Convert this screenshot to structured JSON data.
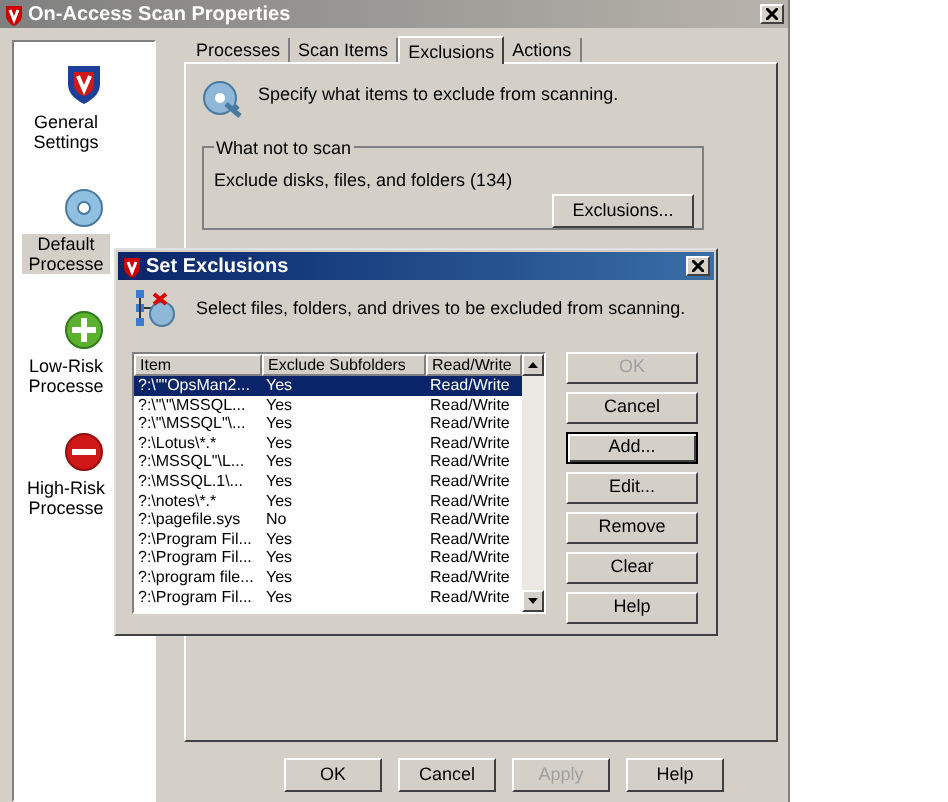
{
  "window": {
    "title": "On-Access Scan Properties"
  },
  "sidebar": {
    "items": [
      {
        "label": "General Settings",
        "kind": "shield",
        "selected": false
      },
      {
        "label": "Default Processe",
        "kind": "disc",
        "selected": true
      },
      {
        "label": "Low-Risk Processe",
        "kind": "plus",
        "selected": false
      },
      {
        "label": "High-Risk Processe",
        "kind": "minus",
        "selected": false
      }
    ]
  },
  "tabs": [
    {
      "label": "Processes",
      "selected": false
    },
    {
      "label": "Scan Items",
      "selected": false
    },
    {
      "label": "Exclusions",
      "selected": true
    },
    {
      "label": "Actions",
      "selected": false
    }
  ],
  "intro": "Specify what items to exclude from scanning.",
  "group": {
    "title": "What not to scan",
    "text": "Exclude disks, files, and folders (134)",
    "button": "Exclusions..."
  },
  "buttons": [
    {
      "label": "OK",
      "disabled": false
    },
    {
      "label": "Cancel",
      "disabled": false
    },
    {
      "label": "Apply",
      "disabled": true
    },
    {
      "label": "Help",
      "disabled": false
    }
  ],
  "dialog": {
    "title": "Set Exclusions",
    "intro": "Select files, folders, and drives to be excluded from scanning.",
    "columns": [
      "Item",
      "Exclude Subfolders",
      "Read/Write"
    ],
    "rows": [
      {
        "cells": [
          "?:\\\"\"OpsMan2...",
          "Yes",
          "Read/Write"
        ],
        "selected": true
      },
      {
        "cells": [
          "?:\\\"\\\"\\MSSQL...",
          "Yes",
          "Read/Write"
        ],
        "selected": false
      },
      {
        "cells": [
          "?:\\\"\\MSSQL\"\\...",
          "Yes",
          "Read/Write"
        ],
        "selected": false
      },
      {
        "cells": [
          "?:\\Lotus\\*.*",
          "Yes",
          "Read/Write"
        ],
        "selected": false
      },
      {
        "cells": [
          "?:\\MSSQL\"\\L...",
          "Yes",
          "Read/Write"
        ],
        "selected": false
      },
      {
        "cells": [
          "?:\\MSSQL.1\\...",
          "Yes",
          "Read/Write"
        ],
        "selected": false
      },
      {
        "cells": [
          "?:\\notes\\*.*",
          "Yes",
          "Read/Write"
        ],
        "selected": false
      },
      {
        "cells": [
          "?:\\pagefile.sys",
          "No",
          "Read/Write"
        ],
        "selected": false
      },
      {
        "cells": [
          "?:\\Program Fil...",
          "Yes",
          "Read/Write"
        ],
        "selected": false
      },
      {
        "cells": [
          "?:\\Program Fil...",
          "Yes",
          "Read/Write"
        ],
        "selected": false
      },
      {
        "cells": [
          "?:\\program file...",
          "Yes",
          "Read/Write"
        ],
        "selected": false
      },
      {
        "cells": [
          "?:\\Program Fil...",
          "Yes",
          "Read/Write"
        ],
        "selected": false
      }
    ],
    "buttons": [
      {
        "label": "OK",
        "disabled": true,
        "focused": false
      },
      {
        "label": "Cancel",
        "disabled": false,
        "focused": false
      },
      {
        "label": "Add...",
        "disabled": false,
        "focused": true
      },
      {
        "label": "Edit...",
        "disabled": false,
        "focused": false
      },
      {
        "label": "Remove",
        "disabled": false,
        "focused": false
      },
      {
        "label": "Clear",
        "disabled": false,
        "focused": false
      },
      {
        "label": "Help",
        "disabled": false,
        "focused": false
      }
    ]
  }
}
